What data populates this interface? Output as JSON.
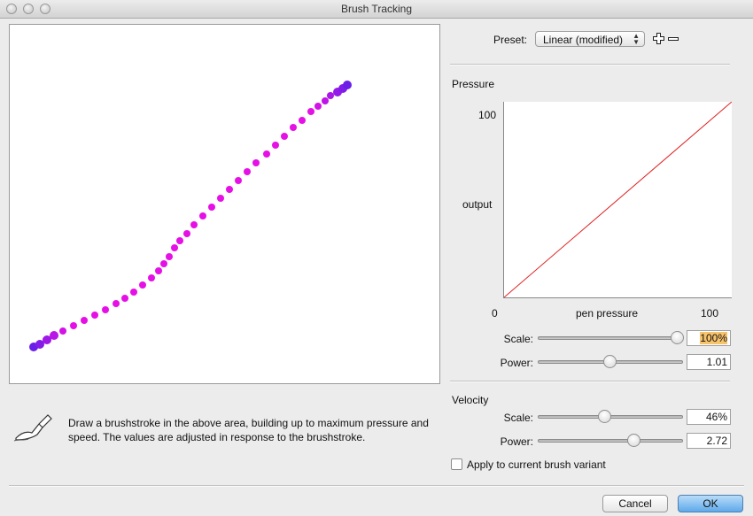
{
  "window": {
    "title": "Brush Tracking"
  },
  "preset": {
    "label": "Preset:",
    "value": "Linear (modified)"
  },
  "help_text": "Draw a brushstroke in the above area, building up to maximum pressure and speed. The values are adjusted in response to the brushstroke.",
  "pressure": {
    "section_label": "Pressure",
    "graph": {
      "y_max_label": "100",
      "y_label": "output",
      "x_min_label": "0",
      "x_label": "pen pressure",
      "x_max_label": "100",
      "line_color": "#e02020"
    },
    "scale": {
      "label": "Scale:",
      "value": "100%",
      "level": 1.0
    },
    "power": {
      "label": "Power:",
      "value": "1.01",
      "level": 0.5
    }
  },
  "velocity": {
    "section_label": "Velocity",
    "scale": {
      "label": "Scale:",
      "value": "46%",
      "level": 0.46
    },
    "power": {
      "label": "Power:",
      "value": "2.72",
      "level": 0.68
    },
    "apply_checkbox": {
      "label": "Apply to current brush variant",
      "checked": false
    }
  },
  "buttons": {
    "cancel": "Cancel",
    "ok": "OK"
  },
  "colors": {
    "stroke_start": "#6a1fe8",
    "stroke_mid": "#e60fe6",
    "stroke_end": "#6a1fe8"
  }
}
